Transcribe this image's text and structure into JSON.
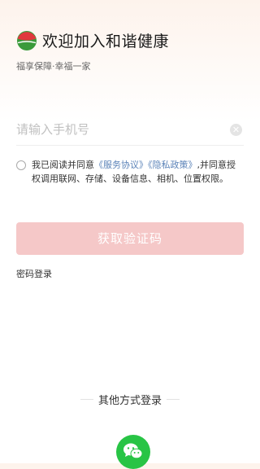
{
  "header": {
    "title": "欢迎加入和谐健康",
    "subtitle": "福享保障·幸福一家"
  },
  "phone": {
    "placeholder": "请输入手机号",
    "value": ""
  },
  "agreement": {
    "prefix": "我已阅读并同意",
    "service_link": "《服务协议》",
    "privacy_link": "《隐私政策》",
    "suffix": ",并同意授权调用联网、存储、设备信息、相机、位置权限。",
    "checked": false
  },
  "get_code_button": "获取验证码",
  "password_login": "密码登录",
  "other_login": {
    "label": "其他方式登录",
    "options": [
      {
        "icon": "wechat-icon"
      }
    ]
  },
  "colors": {
    "accent_red": "#e0393e",
    "logo_green": "#3a9a3a",
    "button_disabled": "#f5c8c8",
    "link": "#5b83b8",
    "wechat": "#28c445"
  }
}
